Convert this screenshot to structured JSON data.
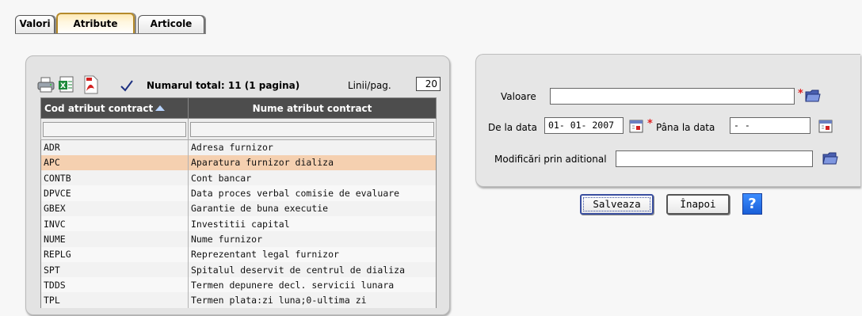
{
  "tabs": [
    {
      "label": "Valori",
      "active": false
    },
    {
      "label": "Atribute",
      "active": true
    },
    {
      "label": "Articole",
      "active": false
    }
  ],
  "toolbar": {
    "icons": [
      "printer-icon",
      "excel-icon",
      "pdf-icon",
      "checkmark-icon"
    ],
    "total_text": "Numarul total: 11 (1 pagina)",
    "lines_label": "Linii/pag.",
    "lines_value": "20"
  },
  "table": {
    "columns": [
      "Cod atribut contract",
      "Nume atribut contract"
    ],
    "sort": "ascending",
    "rows": [
      {
        "code": "ADR",
        "name": "Adresa furnizor",
        "selected": false
      },
      {
        "code": "APC",
        "name": "Aparatura furnizor dializa",
        "selected": true
      },
      {
        "code": "CONTB",
        "name": "Cont bancar",
        "selected": false
      },
      {
        "code": "DPVCE",
        "name": "Data proces verbal comisie de evaluare",
        "selected": false
      },
      {
        "code": "GBEX",
        "name": "Garantie de buna executie",
        "selected": false
      },
      {
        "code": "INVC",
        "name": "Investitii capital",
        "selected": false
      },
      {
        "code": "NUME",
        "name": "Nume furnizor",
        "selected": false
      },
      {
        "code": "REPLG",
        "name": "Reprezentant legal furnizor",
        "selected": false
      },
      {
        "code": "SPT",
        "name": "Spitalul deservit de centrul de dializa",
        "selected": false
      },
      {
        "code": "TDDS",
        "name": "Termen depunere decl. servicii lunara",
        "selected": false
      },
      {
        "code": "TPL",
        "name": "Termen plata:zi luna;0-ultima zi",
        "selected": false
      }
    ]
  },
  "form": {
    "valoare_label": "Valoare",
    "valoare_value": "",
    "de_la_label": "De la data",
    "de_la_value": "01- 01-  2007",
    "pana_la_label": "Pâna la data",
    "pana_la_value": "   -   -",
    "modificari_label": "Modificări prin aditional",
    "modificari_value": "",
    "required_mark": "*"
  },
  "buttons": {
    "save_label": "Salveaza",
    "back_label": "Înapoi",
    "help_label": "?"
  },
  "colors": {
    "selected_row": "#f5d0b0",
    "header_bg": "#4d4d4d",
    "required": "#e02020",
    "help_bg": "#1a5fd8"
  }
}
